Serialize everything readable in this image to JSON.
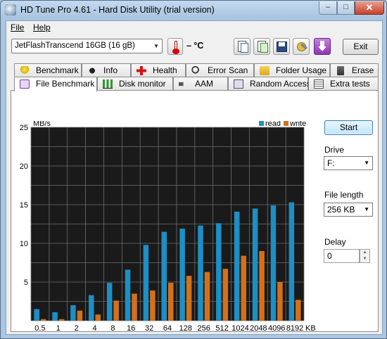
{
  "window": {
    "title": "HD Tune Pro 4.61 - Hard Disk Utility (trial version)",
    "minimize": "–",
    "maximize": "□",
    "close": "✕"
  },
  "menu": {
    "file": "File",
    "help": "Help"
  },
  "toolbar": {
    "drive": "JetFlashTranscend 16GB  (16 gB)",
    "temperature": "– °C",
    "exit_label": "Exit",
    "icons": [
      "copy-text-icon",
      "copy-image-icon",
      "save-icon",
      "options-icon",
      "download-icon"
    ]
  },
  "tabs_row1": [
    {
      "label": "Benchmark",
      "icon": "bulb-icon"
    },
    {
      "label": "Info",
      "icon": "info-icon"
    },
    {
      "label": "Health",
      "icon": "health-cross-icon"
    },
    {
      "label": "Error Scan",
      "icon": "magnifier-icon"
    },
    {
      "label": "Folder Usage",
      "icon": "folder-icon"
    },
    {
      "label": "Erase",
      "icon": "trash-icon"
    }
  ],
  "tabs_row2": [
    {
      "label": "File Benchmark",
      "icon": "file-benchmark-icon",
      "active": true
    },
    {
      "label": "Disk monitor",
      "icon": "disk-monitor-icon"
    },
    {
      "label": "AAM",
      "icon": "speaker-icon"
    },
    {
      "label": "Random Access",
      "icon": "random-access-icon"
    },
    {
      "label": "Extra tests",
      "icon": "extra-tests-icon"
    }
  ],
  "panel": {
    "start_label": "Start",
    "drive_label": "Drive",
    "drive_value": "F:",
    "file_length_label": "File length",
    "file_length_value": "256 KB",
    "delay_label": "Delay",
    "delay_value": "0"
  },
  "chart_data": {
    "type": "bar",
    "ylabel": "MB/s",
    "xunit": "KB",
    "ylim": [
      0,
      25
    ],
    "yticks": [
      5,
      10,
      15,
      20,
      25
    ],
    "grid": true,
    "legend_position": "top-right",
    "categories": [
      "0.5",
      "1",
      "2",
      "4",
      "8",
      "16",
      "32",
      "64",
      "128",
      "256",
      "512",
      "1024",
      "2048",
      "4096",
      "8192"
    ],
    "series": [
      {
        "name": "read",
        "color": "#1d8fc4",
        "values": [
          1.5,
          1.1,
          2.0,
          3.3,
          4.9,
          6.6,
          9.8,
          11.5,
          11.9,
          12.3,
          12.6,
          14.1,
          14.5,
          14.9,
          15.3
        ]
      },
      {
        "name": "write",
        "color": "#d4701a",
        "values": [
          0.2,
          0.2,
          1.3,
          0.8,
          2.6,
          3.5,
          3.9,
          4.9,
          5.8,
          6.3,
          6.7,
          8.4,
          9.0,
          5.0,
          2.7
        ]
      }
    ]
  }
}
